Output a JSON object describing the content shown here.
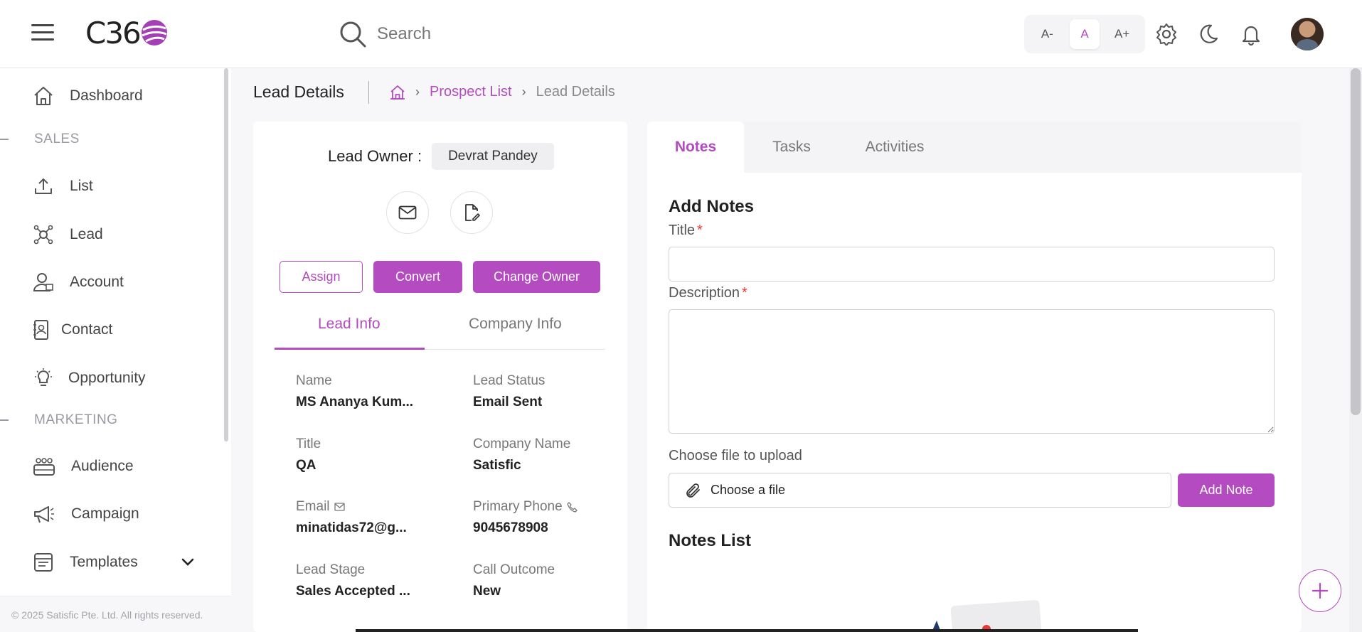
{
  "header": {
    "logo_text": "C36",
    "search_placeholder": "Search",
    "font_sizes": [
      "A-",
      "A",
      "A+"
    ],
    "active_font": "A",
    "accent_color": "#b44bc0"
  },
  "sidebar": {
    "items": [
      {
        "label": "Dashboard",
        "icon": "home-icon"
      },
      {
        "label": "List",
        "icon": "upload-icon"
      },
      {
        "label": "Lead",
        "icon": "network-icon"
      },
      {
        "label": "Account",
        "icon": "user-icon"
      },
      {
        "label": "Contact",
        "icon": "contact-book-icon"
      },
      {
        "label": "Opportunity",
        "icon": "lightbulb-icon"
      },
      {
        "label": "Audience",
        "icon": "group-icon"
      },
      {
        "label": "Campaign",
        "icon": "megaphone-icon"
      },
      {
        "label": "Templates",
        "icon": "template-icon"
      }
    ],
    "sections": {
      "sales": "SALES",
      "marketing": "MARKETING"
    },
    "footer": "© 2025 Satisfic Pte. Ltd. All rights reserved."
  },
  "page": {
    "title": "Lead Details",
    "breadcrumb": {
      "link": "Prospect List",
      "current": "Lead Details"
    }
  },
  "lead": {
    "owner_label": "Lead Owner :",
    "owner_name": "Devrat Pandey",
    "buttons": {
      "assign": "Assign",
      "convert": "Convert",
      "change_owner": "Change Owner"
    },
    "tabs": {
      "lead_info": "Lead Info",
      "company_info": "Company Info"
    },
    "fields": [
      {
        "label": "Name",
        "value": "MS Ananya Kum..."
      },
      {
        "label": "Lead Status",
        "value": "Email Sent"
      },
      {
        "label": "Title",
        "value": "QA"
      },
      {
        "label": "Company Name",
        "value": "Satisfic"
      },
      {
        "label": "Email",
        "value": "minatidas72@g..."
      },
      {
        "label": "Primary Phone",
        "value": "9045678908"
      },
      {
        "label": "Lead Stage",
        "value": "Sales Accepted ..."
      },
      {
        "label": "Call Outcome",
        "value": "New"
      }
    ]
  },
  "notes": {
    "tabs": [
      "Notes",
      "Tasks",
      "Activities"
    ],
    "add_title": "Add Notes",
    "title_label": "Title",
    "description_label": "Description",
    "required_mark": "*",
    "upload_label": "Choose file to upload",
    "choose_file": "Choose a file",
    "add_note_button": "Add Note",
    "list_title": "Notes List"
  }
}
